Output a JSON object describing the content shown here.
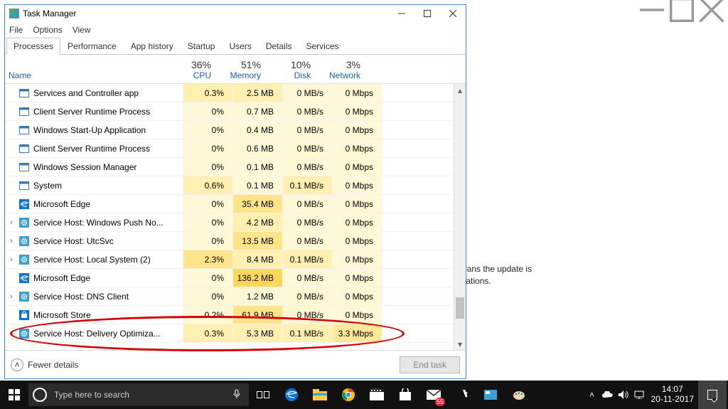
{
  "window": {
    "title": "Task Manager"
  },
  "menus": [
    "File",
    "Options",
    "View"
  ],
  "tabs": [
    "Processes",
    "Performance",
    "App history",
    "Startup",
    "Users",
    "Details",
    "Services"
  ],
  "active_tab": 0,
  "columns": {
    "name": "Name",
    "metrics": [
      {
        "pct": "36%",
        "label": "CPU"
      },
      {
        "pct": "51%",
        "label": "Memory"
      },
      {
        "pct": "10%",
        "label": "Disk"
      },
      {
        "pct": "3%",
        "label": "Network"
      }
    ]
  },
  "processes": [
    {
      "exp": false,
      "name": "Services and Controller app",
      "cpu": "0.3%",
      "mem": "2.5 MB",
      "disk": "0 MB/s",
      "net": "0 Mbps",
      "hc": 1,
      "hm": 1,
      "hd": 0,
      "hn": 0,
      "ic": "app"
    },
    {
      "exp": false,
      "name": "Client Server Runtime Process",
      "cpu": "0%",
      "mem": "0.7 MB",
      "disk": "0 MB/s",
      "net": "0 Mbps",
      "hc": 0,
      "hm": 0,
      "hd": 0,
      "hn": 0,
      "ic": "app"
    },
    {
      "exp": false,
      "name": "Windows Start-Up Application",
      "cpu": "0%",
      "mem": "0.4 MB",
      "disk": "0 MB/s",
      "net": "0 Mbps",
      "hc": 0,
      "hm": 0,
      "hd": 0,
      "hn": 0,
      "ic": "app"
    },
    {
      "exp": false,
      "name": "Client Server Runtime Process",
      "cpu": "0%",
      "mem": "0.6 MB",
      "disk": "0 MB/s",
      "net": "0 Mbps",
      "hc": 0,
      "hm": 0,
      "hd": 0,
      "hn": 0,
      "ic": "app"
    },
    {
      "exp": false,
      "name": "Windows Session Manager",
      "cpu": "0%",
      "mem": "0.1 MB",
      "disk": "0 MB/s",
      "net": "0 Mbps",
      "hc": 0,
      "hm": 0,
      "hd": 0,
      "hn": 0,
      "ic": "app"
    },
    {
      "exp": false,
      "name": "System",
      "cpu": "0.6%",
      "mem": "0.1 MB",
      "disk": "0.1 MB/s",
      "net": "0 Mbps",
      "hc": 1,
      "hm": 0,
      "hd": 1,
      "hn": 0,
      "ic": "app"
    },
    {
      "exp": false,
      "name": "Microsoft Edge",
      "cpu": "0%",
      "mem": "35.4 MB",
      "disk": "0 MB/s",
      "net": "0 Mbps",
      "hc": 0,
      "hm": 2,
      "hd": 0,
      "hn": 0,
      "ic": "edge"
    },
    {
      "exp": true,
      "name": "Service Host: Windows Push No...",
      "cpu": "0%",
      "mem": "4.2 MB",
      "disk": "0 MB/s",
      "net": "0 Mbps",
      "hc": 0,
      "hm": 1,
      "hd": 0,
      "hn": 0,
      "ic": "gear"
    },
    {
      "exp": true,
      "name": "Service Host: UtcSvc",
      "cpu": "0%",
      "mem": "13.5 MB",
      "disk": "0 MB/s",
      "net": "0 Mbps",
      "hc": 0,
      "hm": 2,
      "hd": 0,
      "hn": 0,
      "ic": "gear"
    },
    {
      "exp": true,
      "name": "Service Host: Local System (2)",
      "cpu": "2.3%",
      "mem": "8.4 MB",
      "disk": "0.1 MB/s",
      "net": "0 Mbps",
      "hc": 2,
      "hm": 1,
      "hd": 1,
      "hn": 0,
      "ic": "gear"
    },
    {
      "exp": false,
      "name": "Microsoft Edge",
      "cpu": "0%",
      "mem": "136.2 MB",
      "disk": "0 MB/s",
      "net": "0 Mbps",
      "hc": 0,
      "hm": 3,
      "hd": 0,
      "hn": 0,
      "ic": "edge"
    },
    {
      "exp": true,
      "name": "Service Host: DNS Client",
      "cpu": "0%",
      "mem": "1.2 MB",
      "disk": "0 MB/s",
      "net": "0 Mbps",
      "hc": 0,
      "hm": 0,
      "hd": 0,
      "hn": 0,
      "ic": "gear"
    },
    {
      "exp": false,
      "name": "Microsoft Store",
      "cpu": "0.2%",
      "mem": "61.9 MB",
      "disk": "0 MB/s",
      "net": "0 Mbps",
      "hc": 0,
      "hm": 2,
      "hd": 0,
      "hn": 0,
      "ic": "store"
    },
    {
      "exp": true,
      "name": "Service Host: Delivery Optimiza...",
      "cpu": "0.3%",
      "mem": "5.3 MB",
      "disk": "0.1 MB/s",
      "net": "3.3 Mbps",
      "hc": 1,
      "hm": 1,
      "hd": 1,
      "hn": 1,
      "ic": "gear"
    }
  ],
  "footer": {
    "fewer": "Fewer details",
    "end": "End task"
  },
  "background_text": [
    "means the update is",
    "nizations."
  ],
  "cortana_placeholder": "Type here to search",
  "notifications_badge": "55",
  "clock": {
    "time": "14:07",
    "date": "20-11-2017"
  }
}
